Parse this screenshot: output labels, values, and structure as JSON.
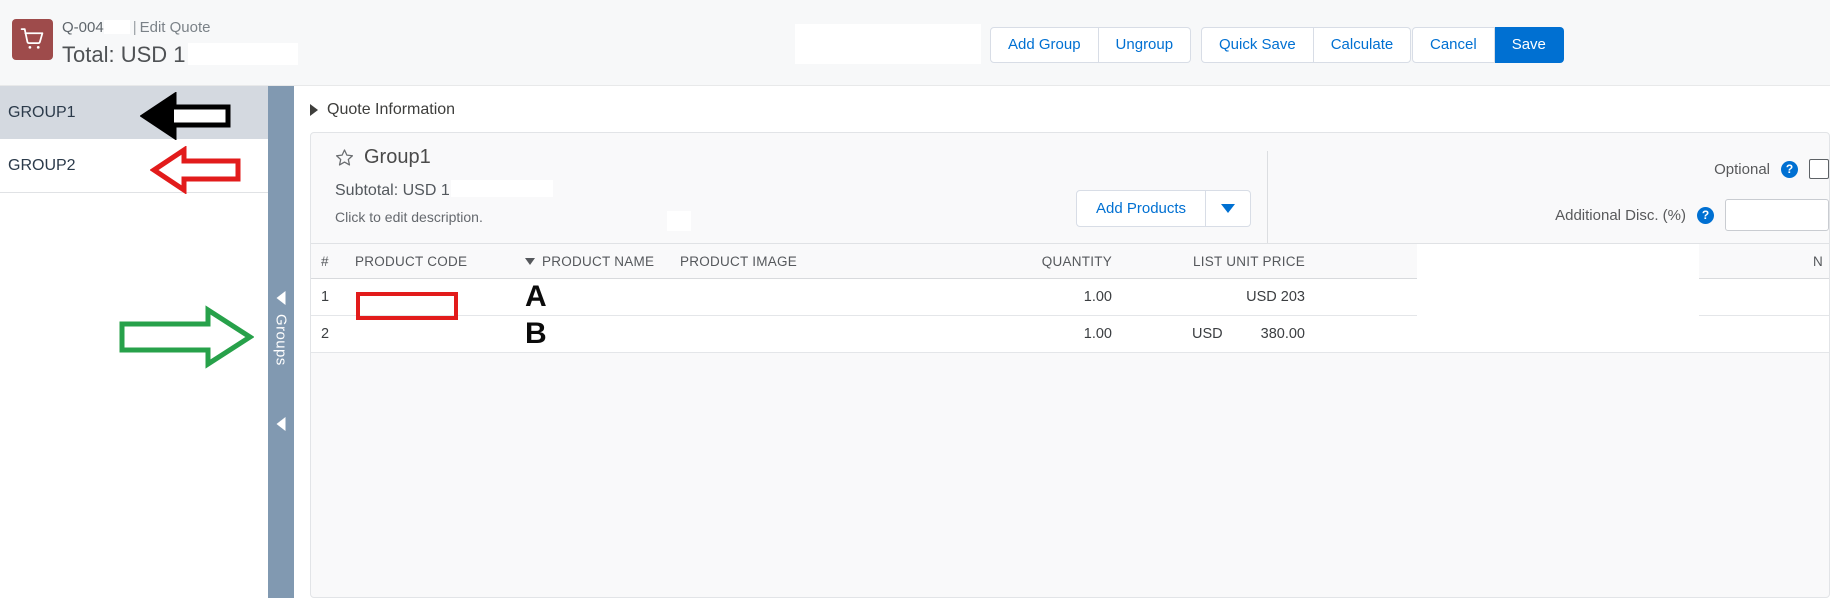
{
  "header": {
    "app_icon": "shopping-cart-icon",
    "quote_id": "Q-004",
    "separator": "|",
    "page_mode": "Edit Quote",
    "total_label": "Total: USD 1",
    "buttons": {
      "add_group": "Add Group",
      "ungroup": "Ungroup",
      "quick_save": "Quick Save",
      "calculate": "Calculate",
      "cancel": "Cancel",
      "save": "Save"
    },
    "accent_color": "#0070d2",
    "icon_color": "#9e4b4b"
  },
  "group_list": {
    "items": [
      {
        "label": "GROUP1",
        "selected": true
      },
      {
        "label": "GROUP2",
        "selected": false
      }
    ]
  },
  "rail": {
    "label": "Groups",
    "color": "#8199b1"
  },
  "main": {
    "quote_information_label": "Quote Information",
    "group_card": {
      "star_icon": "star-outline-icon",
      "title": "Group1",
      "subtotal_label": "Subtotal: USD 1",
      "description_placeholder": "Click to edit description.",
      "add_products_label": "Add Products",
      "add_products_caret_icon": "chevron-down-icon",
      "optional_label": "Optional",
      "optional_help_icon": "help-icon",
      "additional_disc_label": "Additional Disc. (%)",
      "additional_disc_help_icon": "help-icon",
      "additional_disc_value": ""
    },
    "product_table": {
      "columns": [
        "#",
        "PRODUCT CODE",
        "PRODUCT NAME",
        "PRODUCT IMAGE",
        "QUANTITY",
        "LIST UNIT PRICE",
        "N"
      ],
      "sort_indicator_column": "PRODUCT NAME",
      "sort_icon": "chevron-down-icon",
      "rows": [
        {
          "num": "1",
          "product_code": "",
          "product_name": "A",
          "product_image": "",
          "quantity": "1.00",
          "list_unit_price_currency": "USD",
          "list_unit_price_amount": "203",
          "list_unit_price_display": "USD 203"
        },
        {
          "num": "2",
          "product_code": "",
          "product_name": "B",
          "product_image": "",
          "quantity": "1.00",
          "list_unit_price_currency": "USD",
          "list_unit_price_amount": "380.00",
          "list_unit_price_display": "USD 380.00"
        }
      ]
    }
  },
  "annotations": [
    {
      "name": "black-arrow-left",
      "color": "#000000",
      "points_to": "GROUP1"
    },
    {
      "name": "red-arrow-left",
      "color": "#e21b1b",
      "points_to": "GROUP2"
    },
    {
      "name": "green-arrow-right",
      "color": "#27a14a",
      "points_to": "Groups rail"
    },
    {
      "name": "red-rectangle-highlight",
      "color": "#e21b1b",
      "points_to": "product code cell row 1"
    }
  ]
}
